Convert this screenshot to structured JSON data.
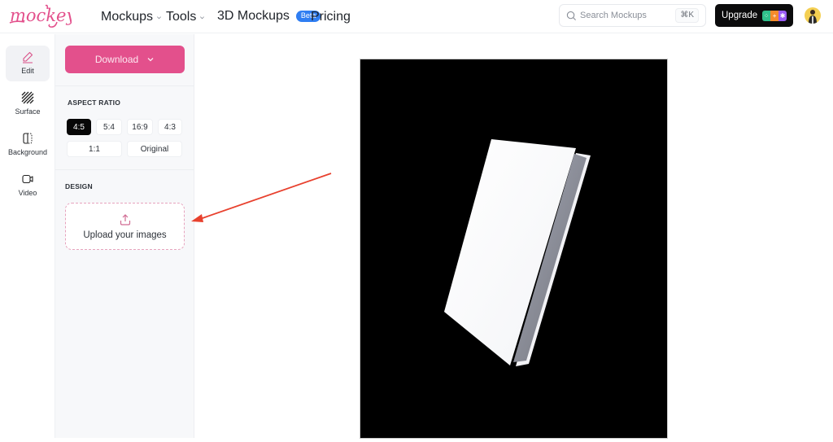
{
  "brand": {
    "name": "mockey",
    "color": "#e3508c"
  },
  "nav": {
    "items": [
      {
        "label": "Mockups",
        "has_dropdown": true
      },
      {
        "label": "Tools",
        "has_dropdown": true
      },
      {
        "label": "3D Mockups",
        "badge": "Beta"
      },
      {
        "label": "Pricing"
      }
    ],
    "search": {
      "placeholder": "Search Mockups",
      "value": "",
      "shortcut": "⌘K",
      "icon": "search-icon"
    },
    "upgrade": {
      "label": "Upgrade",
      "badge_colors": [
        "#2fbf8a",
        "#f58a2a",
        "#9a5cf5"
      ]
    },
    "avatar": {
      "icon": "user-avatar"
    }
  },
  "rail": {
    "items": [
      {
        "label": "Edit",
        "icon": "pencil-icon",
        "active": true
      },
      {
        "label": "Surface",
        "icon": "texture-icon",
        "active": false
      },
      {
        "label": "Background",
        "icon": "background-icon",
        "active": false
      },
      {
        "label": "Video",
        "icon": "video-icon",
        "active": false
      }
    ]
  },
  "panel": {
    "download": {
      "label": "Download",
      "icon": "chevron-down-icon"
    },
    "aspect_ratio": {
      "title": "ASPECT RATIO",
      "options": [
        "4:5",
        "5:4",
        "16:9",
        "4:3",
        "1:1",
        "Original"
      ],
      "selected": "4:5"
    },
    "design": {
      "title": "DESIGN",
      "upload_label": "Upload your images",
      "upload_icon": "upload-icon"
    }
  },
  "canvas": {
    "background_color": "#000000",
    "mockup": "3D book (hardcover, blank white)"
  },
  "annotation": {
    "type": "arrow",
    "color": "#e8412e",
    "target": "upload-your-images"
  }
}
